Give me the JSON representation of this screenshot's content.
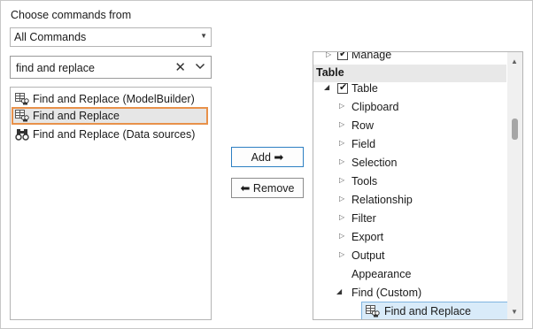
{
  "choose_label": "Choose commands from",
  "command_source": {
    "selected": "All Commands"
  },
  "search": {
    "value": "find and replace"
  },
  "results": [
    {
      "label": "Find and Replace (ModelBuilder)",
      "icon": "find-replace-table-icon",
      "selected": false
    },
    {
      "label": "Find and Replace",
      "icon": "find-replace-table-icon",
      "selected": true
    },
    {
      "label": "Find and Replace (Data sources)",
      "icon": "binoculars-icon",
      "selected": false
    }
  ],
  "buttons": {
    "add": "Add",
    "remove": "Remove"
  },
  "tree": {
    "partial_top": "Manage",
    "category": "Table",
    "tab": "Table",
    "groups": [
      "Clipboard",
      "Row",
      "Field",
      "Selection",
      "Tools",
      "Relationship",
      "Filter",
      "Export",
      "Output"
    ],
    "appearance": "Appearance",
    "custom_group": "Find (Custom)",
    "custom_command": "Find and Replace"
  },
  "colors": {
    "highlight_border": "#e8914a",
    "selection_bg": "#d9ebf9",
    "selection_border": "#7fb4e0",
    "button_focus": "#2d7fc2"
  }
}
